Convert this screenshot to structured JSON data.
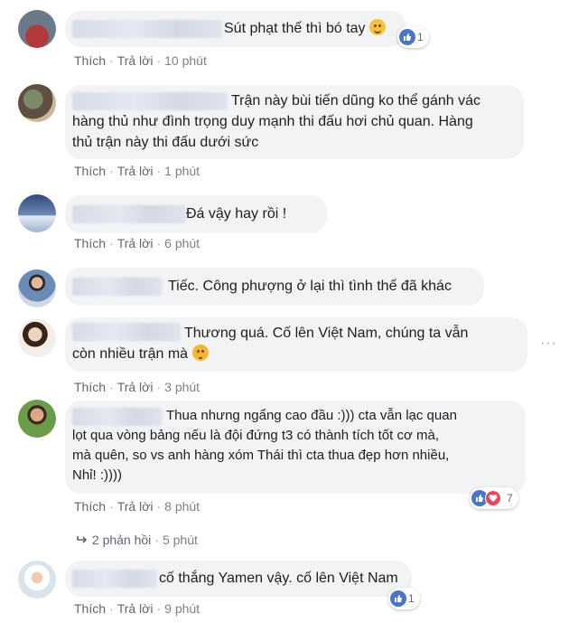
{
  "actions": {
    "like": "Thích",
    "reply": "Trả lời"
  },
  "comments": [
    {
      "text": "Sút phạt thế thì bó tay",
      "time": "10 phút",
      "reactions": "1"
    },
    {
      "text": "Trận này bùi tiến dũng ko thể gánh vác\nhàng thủ như đình trọng duy mạnh thi đấu hơi chủ quan. Hàng\nthủ trận này thi đấu dưới sức",
      "time": "1 phút"
    },
    {
      "text": "Đá vậy hay rồi !",
      "time": "6 phút"
    },
    {
      "text": "Tiếc. Công phượng ở lại thì tình thế đã khác"
    },
    {
      "text": "Thương quá. Cố lên Việt Nam, chúng ta vẫn\ncòn nhiều trận mà",
      "time": "3 phút",
      "more": "···"
    },
    {
      "text": "Thua nhưng ngẩng cao đầu :))) cta vẫn lạc quan\nlọt qua vòng bảng nếu là đội đứng t3 có thành tích tốt cơ mà,\nmà quên, so vs anh hàng xóm Thái thì cta thua đẹp hơn nhiều,\nNhỉ! :))))",
      "time": "8 phút",
      "reactions": "7",
      "replies_label": "2 phản hồi",
      "replies_time": "5 phút"
    },
    {
      "text": "cố thắng Yamen vậy. cố lên Việt Nam",
      "time": "9 phút",
      "reactions": "1"
    }
  ],
  "icons": {
    "like": "like-icon",
    "love": "love-icon",
    "reply_arrow": "reply-arrow-icon",
    "emoji": "smile-emoji-icon"
  },
  "colors": {
    "bubble": "#f2f3f5",
    "like": "#4a76c9",
    "love": "#e8475a",
    "meta": "#7b8089"
  }
}
